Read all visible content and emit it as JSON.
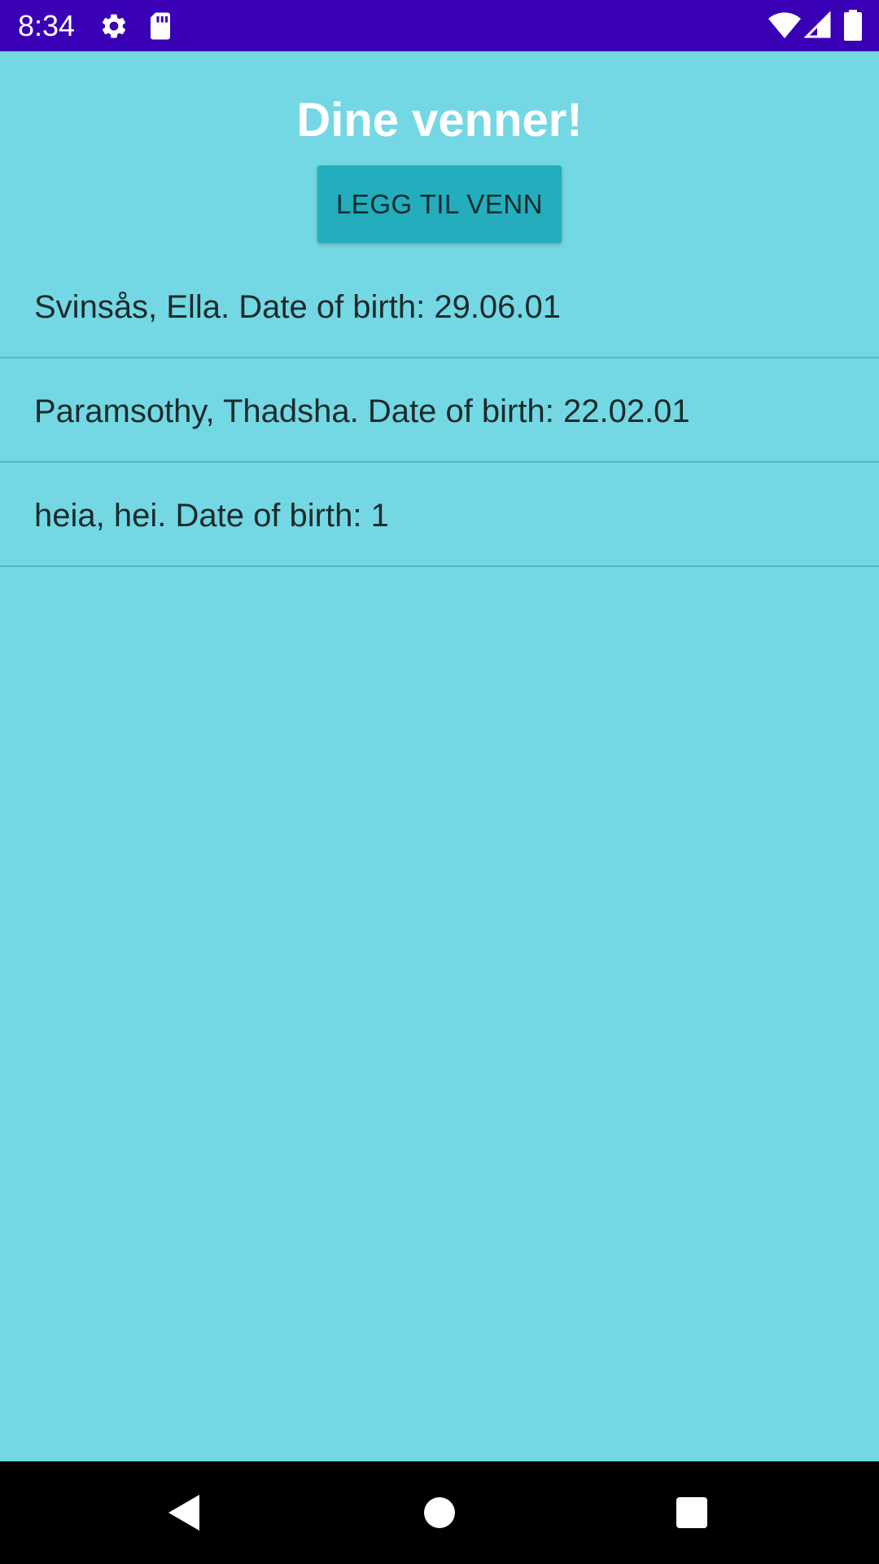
{
  "status_bar": {
    "time": "8:34",
    "icons": [
      "gear-icon",
      "sd-card-icon",
      "wifi-icon",
      "cellular-signal-icon",
      "battery-icon"
    ],
    "background_color": "#3A00B6"
  },
  "screen": {
    "title": "Dine venner!",
    "add_button_label": "LEGG TIL VENN",
    "background_color": "#73D8E3",
    "button_color": "#23ADBD"
  },
  "friends": [
    {
      "text": "Svinsås, Ella. Date of birth: 29.06.01"
    },
    {
      "text": "Paramsothy, Thadsha. Date of birth: 22.02.01"
    },
    {
      "text": "heia, hei. Date of birth: 1"
    }
  ],
  "nav_bar": {
    "buttons": [
      "back-icon",
      "home-icon",
      "recents-icon"
    ]
  }
}
